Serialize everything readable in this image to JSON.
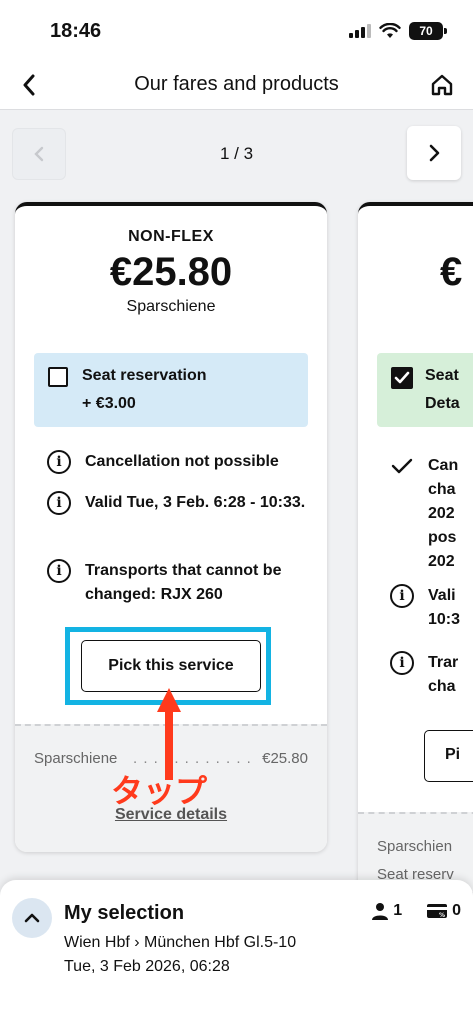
{
  "status_bar": {
    "time": "18:46",
    "battery": "70"
  },
  "nav": {
    "title": "Our fares and products"
  },
  "pager": {
    "label": "1 / 3"
  },
  "offer": {
    "type": "NON-FLEX",
    "price": "€25.80",
    "fare_name": "Sparschiene",
    "seat_reservation": {
      "label": "Seat reservation",
      "price": "+ €3.00",
      "checked": false
    },
    "conditions": [
      "Cancellation not possible",
      "Valid Tue, 3 Feb. 6:28 - 10:33.",
      "Transports that cannot be changed: RJX 260"
    ],
    "pick_label": "Pick this service",
    "footer": {
      "fare_name": "Sparschiene",
      "dots": ". . . . . . . . . . . .",
      "amount": "€25.80",
      "details_link": "Service details"
    }
  },
  "annotation": {
    "text": "タップ",
    "color": "#ff3a1c",
    "frame_color": "#13b3e3"
  },
  "next_offer_peek": {
    "price": "€",
    "seat_title": "Seat",
    "seat_sub": "Deta",
    "conditions": [
      {
        "icon": "check",
        "lines": [
          "Can",
          "cha",
          "202",
          "pos",
          "202"
        ]
      },
      {
        "icon": "info",
        "lines": [
          "Vali",
          "10:3"
        ]
      },
      {
        "icon": "info",
        "lines": [
          "Trar",
          "cha"
        ]
      }
    ],
    "pick_label": "Pi",
    "footer_lines": [
      "Sparschien",
      "Seat reserv"
    ]
  },
  "selection": {
    "title": "My selection",
    "route": "Wien Hbf › München Hbf Gl.5-10",
    "date": "Tue, 3 Feb 2026, 06:28",
    "passengers": "1",
    "discount_cards": "0"
  }
}
